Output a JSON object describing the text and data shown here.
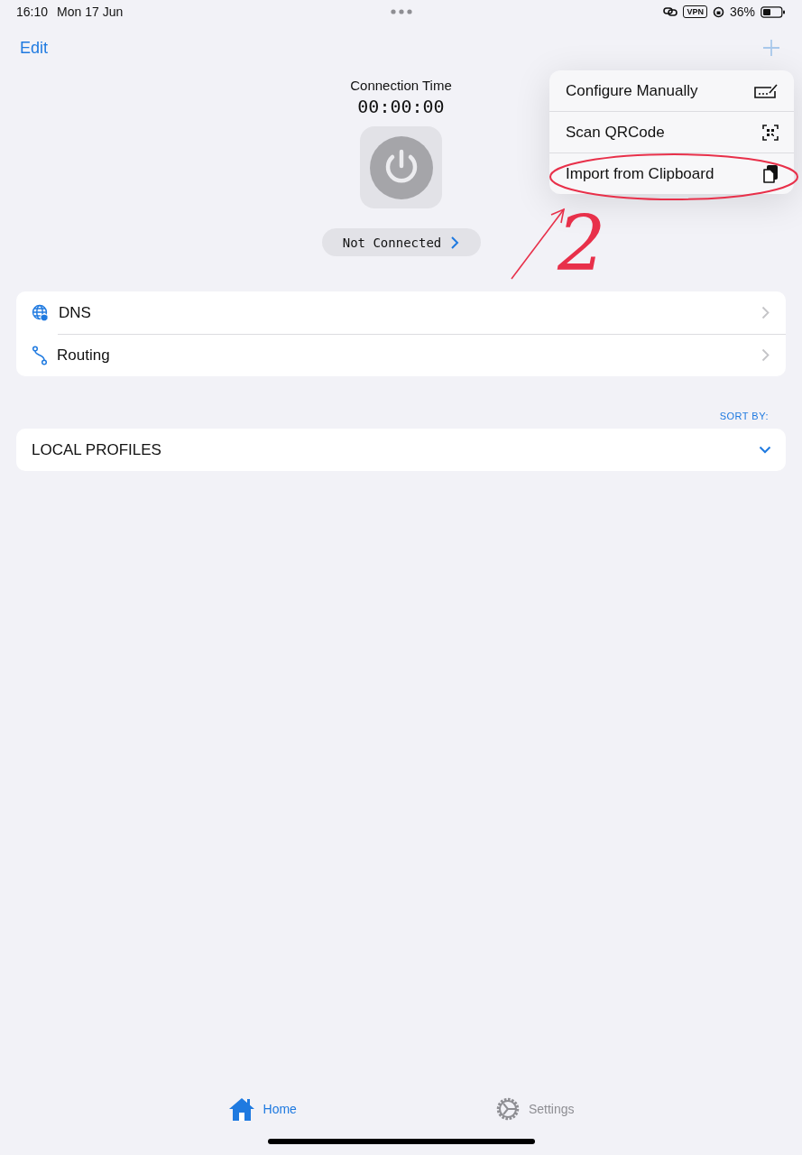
{
  "status_bar": {
    "time": "16:10",
    "date": "Mon 17 Jun",
    "vpn": "VPN",
    "battery": "36%"
  },
  "nav": {
    "edit": "Edit"
  },
  "connection": {
    "label": "Connection Time",
    "time": "00:00:00",
    "status": "Not Connected",
    "connected": false
  },
  "settings_rows": [
    {
      "label": "DNS",
      "kind": "dns"
    },
    {
      "label": "Routing",
      "kind": "routing"
    }
  ],
  "sort_label": "SORT BY:",
  "profiles": {
    "title": "LOCAL PROFILES"
  },
  "menu": {
    "items": [
      {
        "label": "Configure Manually",
        "kind": "manual"
      },
      {
        "label": "Scan QRCode",
        "kind": "qr"
      },
      {
        "label": "Import from Clipboard",
        "kind": "clipboard"
      }
    ]
  },
  "annotation": {
    "label": "2"
  },
  "tabs": [
    {
      "label": "Home",
      "selected": true,
      "kind": "home"
    },
    {
      "label": "Settings",
      "selected": false,
      "kind": "settings"
    }
  ]
}
